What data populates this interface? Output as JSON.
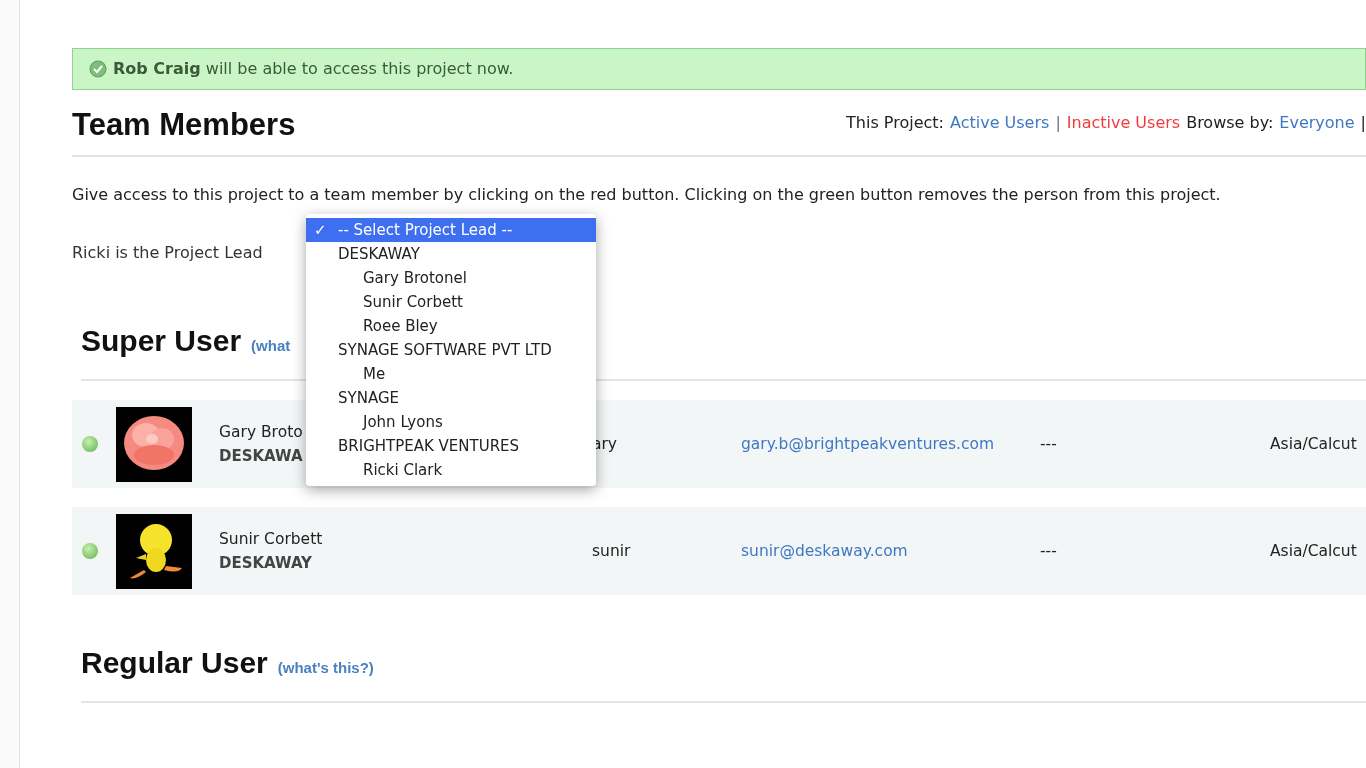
{
  "flash": {
    "name": "Rob Craig",
    "message": "will be able to access this project now."
  },
  "header": {
    "title": "Team Members",
    "filter_label": "This Project:",
    "links": [
      {
        "label": "Active Users",
        "kind": "link"
      },
      {
        "label": "Inactive Users",
        "kind": "danger"
      }
    ],
    "separator": "|",
    "browse_label": "Browse by:",
    "browse_link": "Everyone",
    "trailing": "|"
  },
  "intro": "Give access to this project to a team member by clicking on the red button. Clicking on the green button removes the person from this project.",
  "project_lead": {
    "label": "Ricki is the Project Lead",
    "options": [
      {
        "label": "-- Select Project Lead --",
        "kind": "option",
        "selected": true,
        "check": "✓"
      },
      {
        "label": "DESKAWAY",
        "kind": "group",
        "selected": false
      },
      {
        "label": "Gary Brotonel",
        "kind": "option",
        "selected": false
      },
      {
        "label": "Sunir Corbett",
        "kind": "option",
        "selected": false
      },
      {
        "label": "Roee Bley",
        "kind": "option",
        "selected": false
      },
      {
        "label": "SYNAGE SOFTWARE PVT LTD",
        "kind": "group",
        "selected": false
      },
      {
        "label": "Me",
        "kind": "option",
        "selected": false
      },
      {
        "label": "SYNAGE",
        "kind": "group",
        "selected": false
      },
      {
        "label": "John Lyons",
        "kind": "option",
        "selected": false
      },
      {
        "label": "BRIGHTPEAK VENTURES",
        "kind": "group",
        "selected": false
      },
      {
        "label": "Ricki Clark",
        "kind": "option",
        "selected": false
      }
    ]
  },
  "sections": [
    {
      "title": "Super User",
      "help": "(what",
      "members": [
        {
          "name": "Gary Broto",
          "company": "DESKAWA",
          "username": "ary",
          "email": "gary.b@brightpeakventures.com",
          "phone": "---",
          "timezone": "Asia/Calcut",
          "access": true
        },
        {
          "name": "Sunir Corbett",
          "company": "DESKAWAY",
          "username": "sunir",
          "email": "sunir@deskaway.com",
          "phone": "---",
          "timezone": "Asia/Calcut",
          "access": true
        }
      ]
    },
    {
      "title": "Regular User",
      "help": "(what's this?)"
    }
  ]
}
